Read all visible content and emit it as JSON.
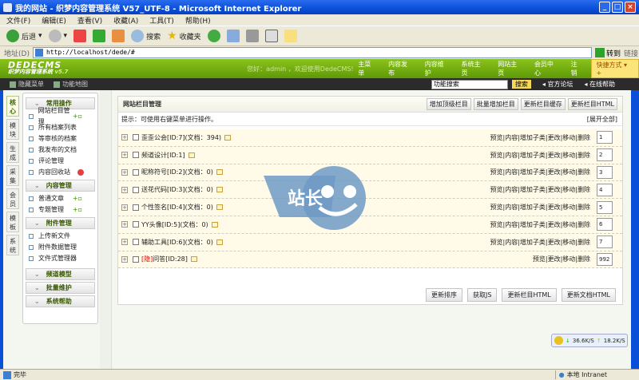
{
  "window": {
    "title": "我的网站 - 织梦内容管理系统 V57_UTF-8 - Microsoft Internet Explorer"
  },
  "menu": [
    "文件(F)",
    "编辑(E)",
    "查看(V)",
    "收藏(A)",
    "工具(T)",
    "帮助(H)"
  ],
  "toolbar": {
    "back": "后退",
    "search": "搜索",
    "favorites": "收藏夹"
  },
  "address": {
    "label": "地址(D)",
    "url": "http://localhost/dede/#",
    "go": "转到",
    "links": "链接"
  },
  "header": {
    "logo": "DEDECMS",
    "logo_sub": "织梦内容管理系统",
    "version": "v5.7",
    "welcome": "您好：admin ，欢迎使用DedeCMS!",
    "nav": [
      "主菜单",
      "内容发布",
      "内容维护",
      "系统主页",
      "网站主页",
      "会员中心",
      "注销"
    ],
    "quick": "快捷方式"
  },
  "subbar": {
    "hide_menu": "隐藏菜单",
    "sitemap": "功能地图",
    "search_value": "功能搜索",
    "search_btn": "搜索",
    "forum": "官方论坛",
    "help": "在线帮助"
  },
  "tabs": [
    "核心",
    "模块",
    "生成",
    "采集",
    "会员",
    "模板",
    "系统"
  ],
  "sidebar": {
    "groups": [
      {
        "title": "常用操作",
        "items": [
          {
            "label": "网站栏目管理",
            "badge": "add"
          },
          {
            "label": "所有档案列表"
          },
          {
            "label": "等审核的档案"
          },
          {
            "label": "我发布的文档"
          },
          {
            "label": "评论管理"
          },
          {
            "label": "内容回收站",
            "badge": "del"
          }
        ]
      },
      {
        "title": "内容管理",
        "items": [
          {
            "label": "普通文章",
            "badge": "add"
          },
          {
            "label": "专题管理",
            "badge": "add"
          }
        ]
      },
      {
        "title": "附件管理",
        "items": [
          {
            "label": "上传新文件"
          },
          {
            "label": "附件数据管理"
          },
          {
            "label": "文件式管理器"
          }
        ]
      },
      {
        "title": "频道模型",
        "items": []
      },
      {
        "title": "批量维护",
        "items": []
      },
      {
        "title": "系统帮助",
        "items": []
      }
    ]
  },
  "panel": {
    "title": "网站栏目管理",
    "buttons": [
      "增加顶级栏目",
      "批量增加栏目",
      "更新栏目缓存",
      "更新栏目HTML"
    ],
    "tip": "提示：可使用右键菜单进行操作。",
    "expand_all": "[展开全部]",
    "rows": [
      {
        "hidden": "",
        "name": "歪歪公会[ID:7](文档：394)",
        "ops": "预览|内容|增加子类|更改|移动|删除",
        "order": "1"
      },
      {
        "hidden": "",
        "name": "频道设计[ID:1]",
        "ops": "预览|内容|增加子类|更改|移动|删除",
        "order": "2"
      },
      {
        "hidden": "",
        "name": "昵称符号[ID:2](文档：0)",
        "ops": "预览|内容|增加子类|更改|移动|删除",
        "order": "3"
      },
      {
        "hidden": "",
        "name": "送花代码[ID:3](文档：0)",
        "ops": "预览|内容|增加子类|更改|移动|删除",
        "order": "4"
      },
      {
        "hidden": "",
        "name": "个性签名[ID:4](文档：0)",
        "ops": "预览|内容|增加子类|更改|移动|删除",
        "order": "5"
      },
      {
        "hidden": "",
        "name": "YY头像[ID:5](文档：0)",
        "ops": "预览|内容|增加子类|更改|移动|删除",
        "order": "6"
      },
      {
        "hidden": "",
        "name": "辅助工具[ID:6](文档：0)",
        "ops": "预览|内容|增加子类|更改|移动|删除",
        "order": "7"
      },
      {
        "hidden": "[隐]",
        "name": "问答[ID:28]",
        "ops": "预览|更改|移动|删除",
        "order": "992"
      }
    ],
    "bottom_buttons": [
      "更新排序",
      "获取JS",
      "更新栏目HTML",
      "更新文档HTML"
    ]
  },
  "watermark": "WWW.ZHAN.COM 站长",
  "speed": {
    "down": "36.6K/S",
    "up": "18.2K/S"
  },
  "status": {
    "text": "完毕",
    "zone": "本地 Intranet"
  }
}
